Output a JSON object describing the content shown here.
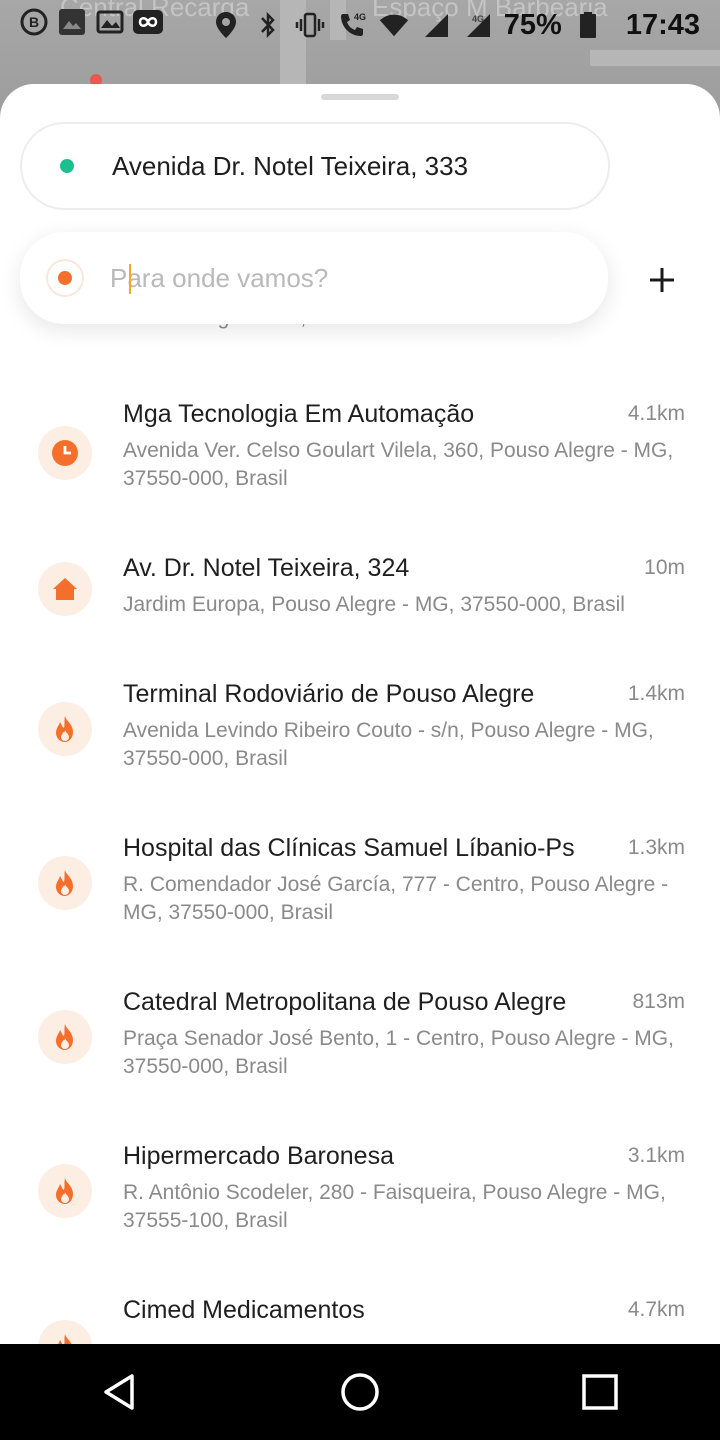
{
  "map": {
    "label_left": "Central Recarga",
    "label_right": "Espaço M Barbearia"
  },
  "status_bar": {
    "battery": "75%",
    "time": "17:43",
    "icons": [
      "whatsapp-business-icon",
      "gallery-icon",
      "image-icon",
      "infinity-app-icon",
      "location-icon",
      "bluetooth-icon",
      "vibrate-icon",
      "call-wifi-icon",
      "wifi-icon",
      "signal-icon",
      "signal-4g-icon",
      "battery-icon"
    ]
  },
  "origin": {
    "address": "Avenida Dr. Notel Teixeira, 333",
    "dot_color": "#1dbf8f"
  },
  "destination": {
    "placeholder": "Para onde vamos?",
    "dot_color": "#f36f2b"
  },
  "accent_color": "#f36f2b",
  "partial_top_item": {
    "address": "Pouso Alegre - MG, Brazil"
  },
  "places": [
    {
      "icon": "clock-icon",
      "title": "Mga Tecnologia Em Automação",
      "address": "Avenida Ver. Celso Goulart Vilela, 360, Pouso Alegre - MG, 37550-000, Brasil",
      "distance": "4.1km"
    },
    {
      "icon": "home-icon",
      "title": "Av. Dr. Notel Teixeira, 324",
      "address": "Jardim Europa, Pouso Alegre - MG, 37550-000, Brasil",
      "distance": "10m"
    },
    {
      "icon": "fire-icon",
      "title": "Terminal Rodoviário de Pouso Alegre",
      "address": "Avenida Levindo Ribeiro Couto - s/n, Pouso Alegre - MG, 37550-000, Brasil",
      "distance": "1.4km"
    },
    {
      "icon": "fire-icon",
      "title": "Hospital das Clínicas Samuel Líbanio-Ps",
      "address": "R. Comendador José García, 777 - Centro, Pouso Alegre - MG, 37550-000, Brasil",
      "distance": "1.3km"
    },
    {
      "icon": "fire-icon",
      "title": "Catedral Metropolitana de Pouso Alegre",
      "address": "Praça Senador José Bento, 1 - Centro, Pouso Alegre - MG, 37550-000, Brasil",
      "distance": "813m"
    },
    {
      "icon": "fire-icon",
      "title": "Hipermercado Baronesa",
      "address": "R. Antônio Scodeler, 280 - Faisqueira, Pouso Alegre - MG, 37555-100, Brasil",
      "distance": "3.1km"
    },
    {
      "icon": "fire-icon",
      "title": "Cimed Medicamentos",
      "address": "",
      "distance": "4.7km"
    }
  ],
  "nav_bar": [
    "back-icon",
    "home-circle-icon",
    "recents-icon"
  ]
}
